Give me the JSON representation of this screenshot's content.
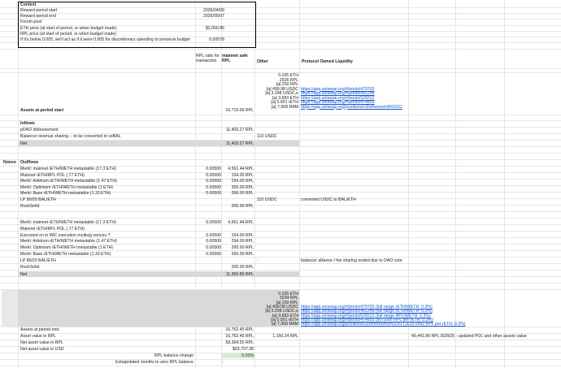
{
  "context": {
    "title": "Context",
    "rows": [
      {
        "label": "Reward period start",
        "value": "2026/04/09"
      },
      {
        "label": "Reward period end",
        "value": "2026/05/07"
      },
      {
        "label": "Forum post",
        "value": ""
      },
      {
        "label": "ETH price (at start of period, or when budget made)",
        "value": "$2,060.86"
      },
      {
        "label": "RPL price (at start of period, or when budget made)",
        "value": ""
      },
      {
        "label": "   If it's below 0.005, we'll act as if it were 0.005 for discretionary spending to preserve budget",
        "value": "0.00078"
      }
    ]
  },
  "headers": {
    "ratio_line1": "RPL ratio for",
    "ratio_line2": "transaction",
    "rpl_line1": "mainnet safe",
    "rpl_line2": "RPL",
    "other": "Other",
    "pol": "Protocol Owned Liquidity"
  },
  "start_other": [
    "0.105 ETH",
    "2926 RPL",
    "[a] 250 RPL",
    "[a] 499.98 USDC",
    "[a] 3.298 USDC,e",
    "[a] 3.683 ETH",
    "[a] 0.001 rETH",
    "[a] 7,958 RAM"
  ],
  "start_links": [
    "https://app.uniswap.org/#/pools/479702",
    "https://app.uniswap.org/#/pools/481248",
    "https://app.uniswap.org/#/pools/526512",
    "https://app.uniswap.org/#/pools/474855",
    "https://app.uniswap.org/positions/v3/ethereum/843291"
  ],
  "assets_start": {
    "label": "Assets at period start",
    "rpl": "16,710.06 RPL"
  },
  "inflows": {
    "title": "Inflows",
    "rows": [
      {
        "label": "pDAO disbursement",
        "rpl": "11,403.27 RPL",
        "other": ""
      },
      {
        "label": "Balancer revenue sharing -- to be converted to veBAL",
        "rpl": "",
        "other": "110 USDC"
      }
    ],
    "net": {
      "label": "Net",
      "rpl": "11,403.27 RPL"
    }
  },
  "outflows": {
    "side": "Nonce",
    "title": "Outflows",
    "group1": [
      {
        "label": "Merkl: mainnet rETH/WETH metastable (17.3 ETH)",
        "ratio": "0.00500",
        "rpl": "4,561.44 RPL",
        "other": "",
        "note": ""
      },
      {
        "label": "Mainnet rETH/RPL POL (.77 ETH)",
        "ratio": "0.00500",
        "rpl": "154.00 RPL",
        "other": "",
        "note": ""
      },
      {
        "label": "Merkl: Arbitrum rETH/WETH metastable (1.47 ETH)",
        "ratio": "0.00500",
        "rpl": "294.00 RPL",
        "other": "",
        "note": ""
      },
      {
        "label": "Merkl: Optimism rETH/WETH metastable (1 ETH)",
        "ratio": "0.00500",
        "rpl": "200.00 RPL",
        "other": "",
        "note": ""
      },
      {
        "label": "Merkl: Base rETH/WETH metastable (1.33 ETH)",
        "ratio": "0.00500",
        "rpl": "266.00 RPL",
        "other": "",
        "note": ""
      },
      {
        "label": "LP 80/20 BAL/ETH",
        "ratio": "",
        "rpl": "",
        "other": "110 USDC",
        "note": "converted USDC to BAL/ETH"
      },
      {
        "label": "RockSolid",
        "ratio": "",
        "rpl": "200.00 RPL",
        "other": "",
        "note": ""
      }
    ],
    "group2": [
      {
        "label": "Merkl: mainnet rETH/WETH metastable (17.3 ETH)",
        "ratio": "0.00500",
        "rpl": "4,561.44 RPL",
        "other": "",
        "note": ""
      },
      {
        "label": "Mainnet rETH/RPL POL (.77 ETH)",
        "ratio": "",
        "rpl": "",
        "other": "",
        "note": ""
      },
      {
        "label": "Executed on in IMC execution multisig nonces ?",
        "ratio": "0.00500",
        "rpl": "154.00 RPL",
        "other": "",
        "note": ""
      },
      {
        "label": "Merkl: Arbitrum rETH/WETH metastable (1.47 ETH)",
        "ratio": "0.00500",
        "rpl": "294.00 RPL",
        "other": "",
        "note": ""
      },
      {
        "label": "Merkl: Optimism rETH/WETH metastable (1 ETH)",
        "ratio": "0.00500",
        "rpl": "200.00 RPL",
        "other": "",
        "note": ""
      },
      {
        "label": "Merkl: Base rETH/WETH metastable (1.33 ETH)",
        "ratio": "0.00500",
        "rpl": "266.00 RPL",
        "other": "",
        "note": ""
      },
      {
        "label": "LP 80/20 BAL/ETH",
        "ratio": "",
        "rpl": "",
        "other": "-",
        "note": "balancer alliance / fee sharing ended due to DAO vote"
      },
      {
        "label": "RockSolid",
        "ratio": "",
        "rpl": "200.00 RPL",
        "other": "",
        "note": ""
      }
    ],
    "net": {
      "label": "Net",
      "rpl": "11,350.86 RPL"
    }
  },
  "end_other": [
    "0.105 ETH",
    "3234 RPL",
    "[a] 250 RPL",
    "[a] 499.98 USDC",
    "[a] 3.298 USDC,e",
    "[a] 3.683 ETH",
    "[a] 0.001 rETH",
    "[a] 7,958 RAM"
  ],
  "end_links": [
    "https://app.uniswap.org/#/pools/479702 (full range rETH/WETH: 0.3%)",
    "https://app.uniswap.org/#/pools/481248 (full range rETH/WETH: 0.3%)",
    "https://app.uniswap.org/#/pools/526512 (full range RPL/WETH: 0.3%)",
    "https://app.uniswap.org/#/pools/474855 (80-1006 RPL per rETH: 0.3%)",
    "https://app.uniswap.org/positions/v3/ethereum/843291 (1120-2992 RPL per rETH: 0.3%)"
  ],
  "summary": [
    {
      "label": "Assets at period end",
      "rpl": "16,762.45 RPL",
      "other": "",
      "extra": ""
    },
    {
      "label": "Asset value in RPL",
      "rpl": "16,762.45 RPL",
      "other": "1,160.24 RPL",
      "extra": "40,441.86 RPL  8/28/25 - updated POL and other assets value"
    },
    {
      "label": "Net asset value in RPL",
      "rpl": "58,364.55 RPL",
      "other": "",
      "extra": ""
    },
    {
      "label": "Net asset value in USD",
      "rpl": "$93,707.38",
      "other": "",
      "extra": ""
    }
  ],
  "balance_change": {
    "label": "RPL balance change",
    "value": "0.31%"
  },
  "extrapolated": {
    "label": "Extrapolated months to zero RPL balance",
    "value": "-"
  },
  "colors": {
    "grey": "#d9d9d9",
    "green": "#d9ead3",
    "link": "#1155cc"
  }
}
